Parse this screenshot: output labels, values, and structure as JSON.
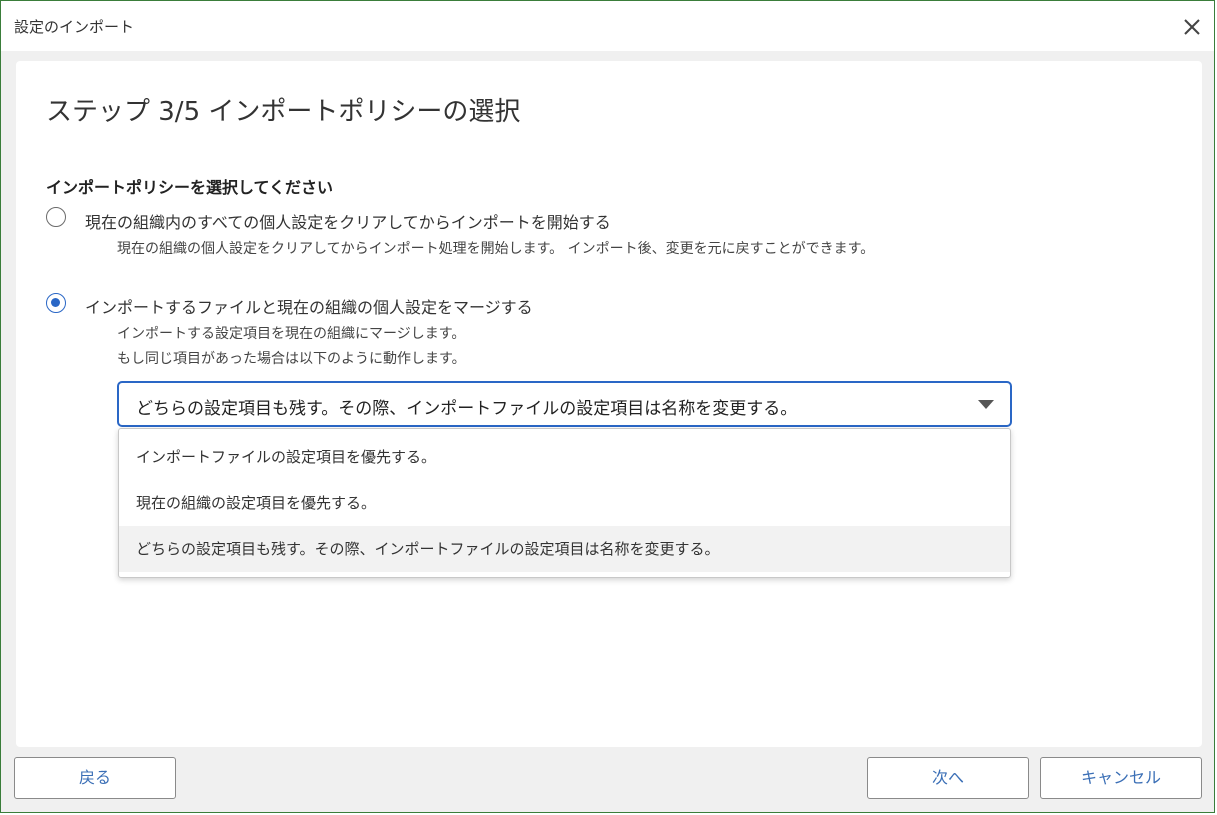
{
  "window": {
    "title": "設定のインポート",
    "close_icon": "close-icon"
  },
  "wizard": {
    "step_title": "ステップ 3/5 インポートポリシーの選択",
    "section_label": "インポートポリシーを選択してください",
    "options": [
      {
        "label": "現在の組織内のすべての個人設定をクリアしてからインポートを開始する",
        "description_lines": [
          "現在の組織の個人設定をクリアしてからインポート処理を開始します。 インポート後、変更を元に戻すことができます。"
        ],
        "selected": false
      },
      {
        "label": "インポートするファイルと現在の組織の個人設定をマージする",
        "description_lines": [
          "インポートする設定項目を現在の組織にマージします。",
          "もし同じ項目があった場合は以下のように動作します。"
        ],
        "selected": true
      }
    ],
    "merge_select": {
      "value": "どちらの設定項目も残す。その際、インポートファイルの設定項目は名称を変更する。",
      "options": [
        "インポートファイルの設定項目を優先する。",
        "現在の組織の設定項目を優先する。",
        "どちらの設定項目も残す。その際、インポートファイルの設定項目は名称を変更する。"
      ],
      "selected_index": 2
    }
  },
  "footer": {
    "back_label": "戻る",
    "next_label": "次へ",
    "cancel_label": "キャンセル"
  },
  "colors": {
    "accent": "#2a67c6",
    "button_text": "#3b6fb6",
    "window_border": "#3a7d3a"
  }
}
